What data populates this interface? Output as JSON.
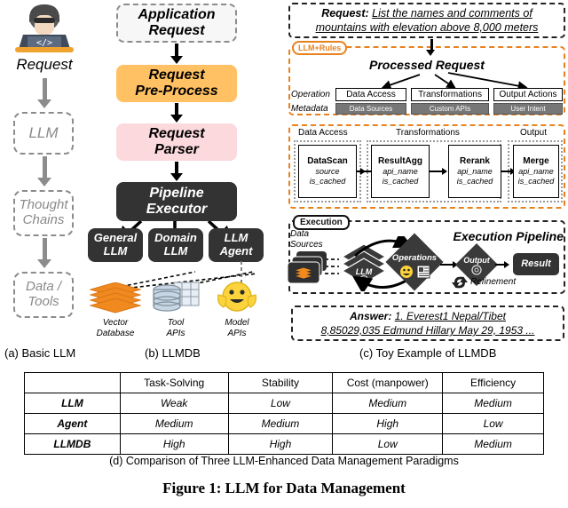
{
  "figure": {
    "caption": "Figure 1: LLM for Data Management"
  },
  "panel_a": {
    "caption": "(a) Basic LLM",
    "actor_icon": "developer-laptop-icon",
    "actor_label": "Request",
    "nodes": [
      {
        "label": "LLM"
      },
      {
        "label": "Thought\nChains",
        "line1": "Thought",
        "line2": "Chains"
      },
      {
        "label": "Data /\nTools",
        "line1": "Data /",
        "line2": "Tools"
      }
    ]
  },
  "panel_b": {
    "caption": "(b) LLMDB",
    "flow": [
      {
        "id": "application-request",
        "line1": "Application",
        "line2": "Request",
        "style": "dashed"
      },
      {
        "id": "request-pre-process",
        "line1": "Request",
        "line2": "Pre-Process",
        "style": "orange"
      },
      {
        "id": "request-parser",
        "line1": "Request",
        "line2": "Parser",
        "style": "pink"
      },
      {
        "id": "pipeline-executor",
        "line1": "Pipeline",
        "line2": "Executor",
        "style": "black"
      }
    ],
    "executors": [
      {
        "id": "general-llm",
        "line1": "General",
        "line2": "LLM"
      },
      {
        "id": "domain-llm",
        "line1": "Domain",
        "line2": "LLM"
      },
      {
        "id": "llm-agent",
        "line1": "LLM",
        "line2": "Agent"
      }
    ],
    "resources": [
      {
        "id": "vector-database",
        "icon": "layers-stack-icon",
        "line1": "Vector",
        "line2": "Database"
      },
      {
        "id": "tool-apis",
        "icon": "database-cylinder-icon",
        "line1": "Tool",
        "line2": "APIs"
      },
      {
        "id": "model-apis",
        "icon": "hugging-face-icon",
        "line1": "Model",
        "line2": "APIs"
      }
    ]
  },
  "panel_c": {
    "caption": "(c) Toy Example of LLMDB",
    "request": {
      "label": "Request:",
      "line1": "List the names and comments of",
      "line2": "mountains with elevation above 8,000 meters"
    },
    "llm_rules_tag": "LLM+Rules",
    "processed_title": "Processed Request",
    "row_labels": {
      "operation": "Operation",
      "metadata": "Metadata"
    },
    "operations": [
      {
        "op": "Data Access",
        "meta": "Data Sources"
      },
      {
        "op": "Transformations",
        "meta": "Custom APIs"
      },
      {
        "op": "Output Actions",
        "meta": "User Intent"
      }
    ],
    "stage_groups": [
      {
        "label": "Data Access"
      },
      {
        "label": "Transformations"
      },
      {
        "label": "Output"
      }
    ],
    "pipeline_nodes": [
      {
        "name": "DataScan",
        "attr1": "source",
        "attr2": "is_cached"
      },
      {
        "name": "ResultAgg",
        "attr1": "api_name",
        "attr2": "is_cached"
      },
      {
        "name": "Rerank",
        "attr1": "api_name",
        "attr2": "is_cached"
      },
      {
        "name": "Merge",
        "attr1": "api_name",
        "attr2": "is_cached"
      }
    ],
    "execution": {
      "tag": "Execution",
      "title": "Execution Pipeline",
      "data_sources_line1": "Data",
      "data_sources_line2": "Sources",
      "llm_label": "LLM",
      "operations_label": "Operations",
      "output_label": "Output",
      "result_label": "Result",
      "refinement_label": "Refinement"
    },
    "answer": {
      "label": "Answer:",
      "line1": "1. Everest1  Nepal/Tibet",
      "line2": "8,85029,035   Edmund Hillary May 29, 1953 ..."
    }
  },
  "panel_d": {
    "caption": "(d) Comparison of Three LLM-Enhanced Data Management Paradigms",
    "columns": [
      "",
      "Task-Solving",
      "Stability",
      "Cost (manpower)",
      "Efficiency"
    ],
    "rows": [
      {
        "name": "LLM",
        "values": [
          "Weak",
          "Low",
          "Medium",
          "Medium"
        ]
      },
      {
        "name": "Agent",
        "values": [
          "Medium",
          "Medium",
          "High",
          "Low"
        ]
      },
      {
        "name": "LLMDB",
        "values": [
          "High",
          "High",
          "Low",
          "Medium"
        ]
      }
    ]
  },
  "colors": {
    "orange": "#ffc163",
    "pink": "#fbd9dd",
    "dark": "#333333",
    "accent_orange": "#e8821e",
    "gray_dash": "#8c8c8c",
    "meta_gray": "#777777"
  }
}
